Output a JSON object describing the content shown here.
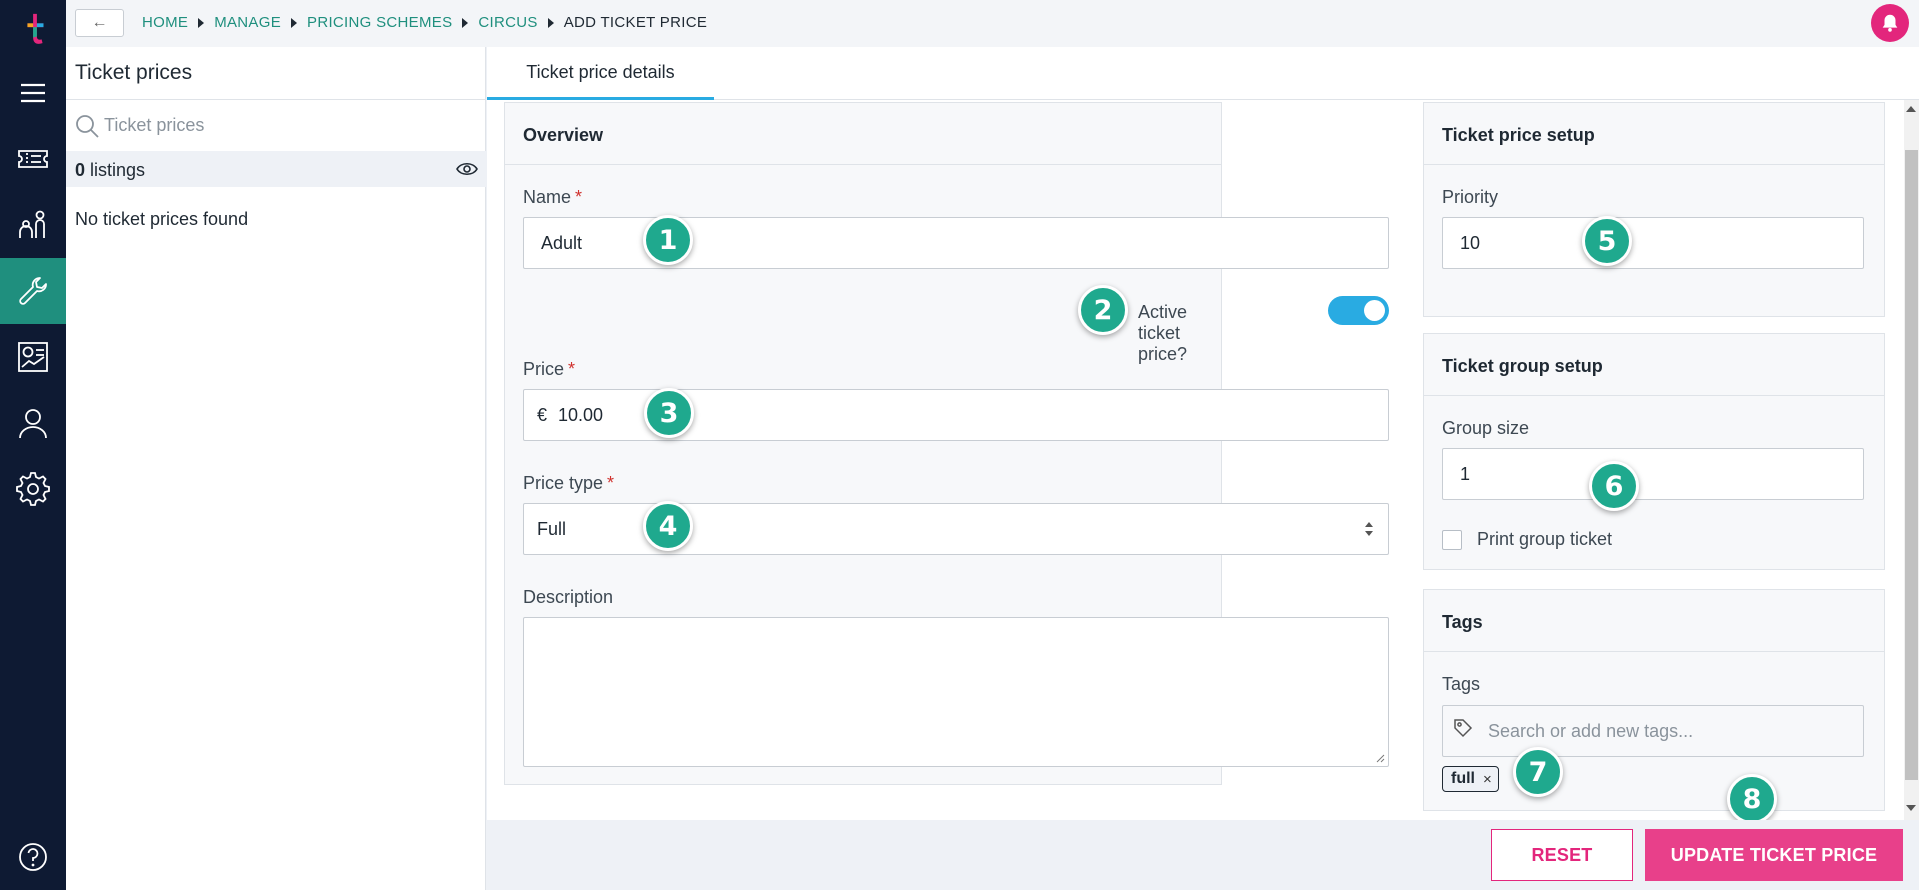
{
  "breadcrumb": {
    "back_label": "←",
    "items": [
      "HOME",
      "MANAGE",
      "PRICING SCHEMES",
      "CIRCUS"
    ],
    "current": "ADD TICKET PRICE"
  },
  "list_panel": {
    "title": "Ticket prices",
    "search_placeholder": "Ticket prices",
    "listing_count": "0",
    "listing_label": "listings",
    "empty_text": "No ticket prices found"
  },
  "tabs": [
    {
      "label": "Ticket price details",
      "active": true
    }
  ],
  "overview": {
    "title": "Overview",
    "name_label": "Name",
    "name_value": "Adult",
    "active_label": "Active ticket price?",
    "active": true,
    "price_label": "Price",
    "currency": "€",
    "price_value": "10.00",
    "price_type_label": "Price type",
    "price_type_value": "Full",
    "description_label": "Description",
    "description_value": "",
    "required_mark": "*"
  },
  "setup": {
    "title": "Ticket price setup",
    "priority_label": "Priority",
    "priority_value": "10"
  },
  "group_setup": {
    "title": "Ticket group setup",
    "group_size_label": "Group size",
    "group_size_value": "1",
    "print_group_label": "Print group ticket",
    "print_group_checked": false
  },
  "tags": {
    "title": "Tags",
    "label": "Tags",
    "placeholder": "Search or add new tags...",
    "items": [
      "full"
    ],
    "remove_glyph": "×"
  },
  "annotations": [
    "1",
    "2",
    "3",
    "4",
    "5",
    "6",
    "7",
    "8"
  ],
  "footer": {
    "reset_label": "RESET",
    "update_label": "UPDATE TICKET PRICE"
  },
  "colors": {
    "nav_bg": "#0e1a33",
    "nav_active": "#1f8f7e",
    "brand_pink": "#e3267c",
    "toggle_on": "#29abe2",
    "badge_green": "#1fa98e"
  },
  "icons": [
    "logo-icon",
    "menu-icon",
    "tickets-icon",
    "visitors-icon",
    "wrench-icon",
    "reports-icon",
    "user-icon",
    "gear-icon",
    "help-icon",
    "bell-icon",
    "search-icon",
    "eye-icon",
    "tag-icon"
  ]
}
